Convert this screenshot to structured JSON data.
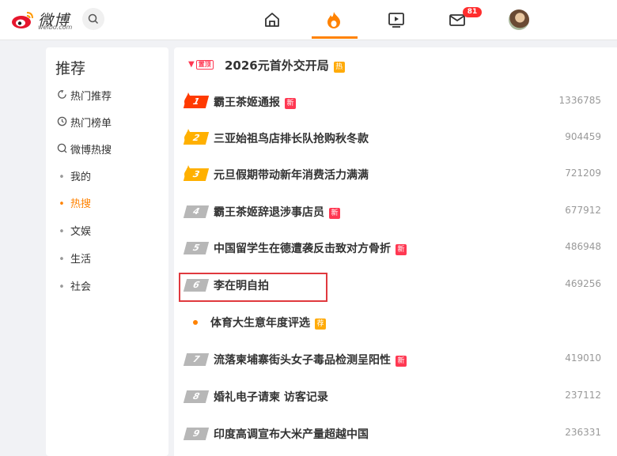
{
  "header": {
    "brand": "微博",
    "brand_sub": "weibo.com",
    "notification_count": "81",
    "colors": {
      "accent": "#ff8200",
      "badge": "#ff2d2d"
    }
  },
  "sidebar": {
    "title": "推荐",
    "items": [
      {
        "icon": "refresh-icon",
        "label": "热门推荐"
      },
      {
        "icon": "clock-icon",
        "label": "热门榜单"
      },
      {
        "icon": "search-icon",
        "label": "微博热搜"
      },
      {
        "icon": "dot",
        "label": "我的"
      },
      {
        "icon": "dot",
        "label": "热搜",
        "active": true
      },
      {
        "icon": "dot",
        "label": "文娱"
      },
      {
        "icon": "dot",
        "label": "生活"
      },
      {
        "icon": "dot",
        "label": "社会"
      }
    ]
  },
  "hot_list": {
    "pinned": {
      "label": "置顶",
      "title": "2026元首外交开局",
      "tag": "热"
    },
    "items": [
      {
        "rank": "1",
        "title": "霸王茶姬通报",
        "tag": "新",
        "count": "1336785"
      },
      {
        "rank": "2",
        "title": "三亚始祖鸟店排长队抢购秋冬款",
        "tag": "",
        "count": "904459"
      },
      {
        "rank": "3",
        "title": "元旦假期带动新年消费活力满满",
        "tag": "",
        "count": "721209"
      },
      {
        "rank": "4",
        "title": "霸王茶姬辞退涉事店员",
        "tag": "新",
        "count": "677912"
      },
      {
        "rank": "5",
        "title": "中国留学生在德遭袭反击致对方骨折",
        "tag": "新",
        "count": "486948"
      },
      {
        "rank": "6",
        "title": "李在明自拍",
        "tag": "",
        "count": "469256"
      },
      {
        "rank": "",
        "title": "体育大生意年度评选",
        "tag": "荐",
        "count": ""
      },
      {
        "rank": "7",
        "title": "流落柬埔寨街头女子毒品检测呈阳性",
        "tag": "新",
        "count": "419010"
      },
      {
        "rank": "8",
        "title": "婚礼电子请柬 访客记录",
        "tag": "",
        "count": "237112"
      },
      {
        "rank": "9",
        "title": "印度高调宣布大米产量超越中国",
        "tag": "",
        "count": "236331"
      }
    ]
  }
}
